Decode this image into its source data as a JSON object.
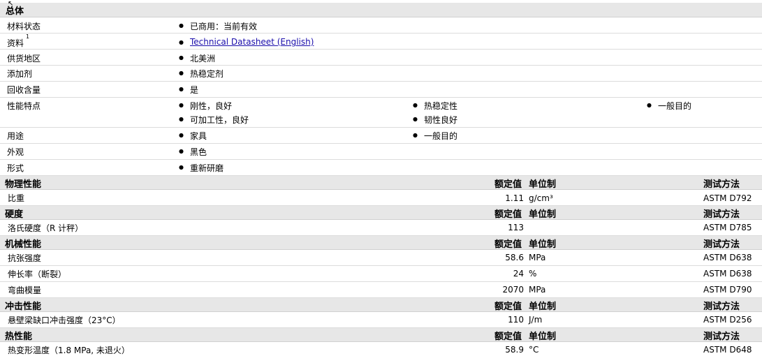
{
  "general": {
    "title": "总体",
    "rows": [
      {
        "label": "材料状态",
        "items": [
          "已商用：当前有效"
        ]
      },
      {
        "label": "资料",
        "sup": "1",
        "link": "Technical Datasheet (English)"
      },
      {
        "label": "供货地区",
        "items": [
          "北美洲"
        ]
      },
      {
        "label": "添加剂",
        "items": [
          "热稳定剂"
        ]
      },
      {
        "label": "回收含量",
        "items": [
          "是"
        ]
      },
      {
        "label": "性能特点",
        "items": [
          "刚性，良好",
          "可加工性，良好",
          "热稳定性",
          "韧性良好",
          "一般目的"
        ]
      },
      {
        "label": "用途",
        "items": [
          "家具",
          "一般目的"
        ]
      },
      {
        "label": "外观",
        "items": [
          "黑色"
        ]
      },
      {
        "label": "形式",
        "items": [
          "重新研磨"
        ]
      }
    ]
  },
  "columns": {
    "nominal": "额定值",
    "unit": "单位制",
    "method": "测试方法"
  },
  "sections": [
    {
      "title": "物理性能",
      "rows": [
        {
          "label": "比重",
          "value": "1.11",
          "unit": "g/cm³",
          "method": "ASTM D792"
        }
      ]
    },
    {
      "title": "硬度",
      "rows": [
        {
          "label": "洛氏硬度（R 计秤）",
          "value": "113",
          "unit": "",
          "method": "ASTM D785"
        }
      ]
    },
    {
      "title": "机械性能",
      "rows": [
        {
          "label": "抗张强度",
          "value": "58.6",
          "unit": "MPa",
          "method": "ASTM D638"
        },
        {
          "label": "伸长率（断裂）",
          "value": "24",
          "unit": "%",
          "method": "ASTM D638"
        },
        {
          "label": "弯曲模量",
          "value": "2070",
          "unit": "MPa",
          "method": "ASTM D790"
        }
      ]
    },
    {
      "title": "冲击性能",
      "rows": [
        {
          "label": "悬壁梁缺口冲击强度（23°C）",
          "value": "110",
          "unit": "J/m",
          "method": "ASTM D256"
        }
      ]
    },
    {
      "title": "热性能",
      "rows": [
        {
          "label": "热变形温度（1.8 MPa, 未退火）",
          "value": "58.9",
          "unit": "°C",
          "method": "ASTM D648"
        }
      ]
    }
  ]
}
